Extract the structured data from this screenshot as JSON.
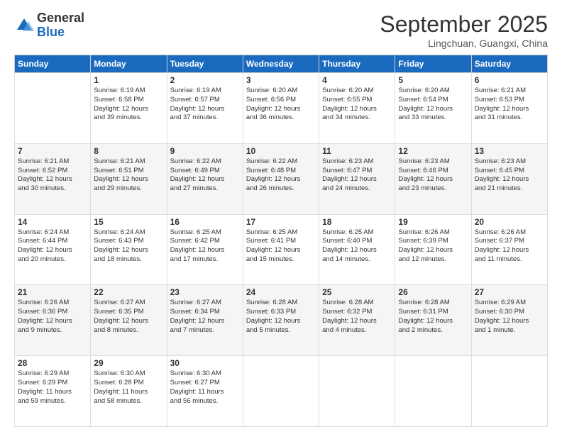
{
  "logo": {
    "general": "General",
    "blue": "Blue"
  },
  "title": "September 2025",
  "location": "Lingchuan, Guangxi, China",
  "days_of_week": [
    "Sunday",
    "Monday",
    "Tuesday",
    "Wednesday",
    "Thursday",
    "Friday",
    "Saturday"
  ],
  "weeks": [
    [
      {
        "day": "",
        "info": ""
      },
      {
        "day": "1",
        "info": "Sunrise: 6:19 AM\nSunset: 6:58 PM\nDaylight: 12 hours\nand 39 minutes."
      },
      {
        "day": "2",
        "info": "Sunrise: 6:19 AM\nSunset: 6:57 PM\nDaylight: 12 hours\nand 37 minutes."
      },
      {
        "day": "3",
        "info": "Sunrise: 6:20 AM\nSunset: 6:56 PM\nDaylight: 12 hours\nand 36 minutes."
      },
      {
        "day": "4",
        "info": "Sunrise: 6:20 AM\nSunset: 6:55 PM\nDaylight: 12 hours\nand 34 minutes."
      },
      {
        "day": "5",
        "info": "Sunrise: 6:20 AM\nSunset: 6:54 PM\nDaylight: 12 hours\nand 33 minutes."
      },
      {
        "day": "6",
        "info": "Sunrise: 6:21 AM\nSunset: 6:53 PM\nDaylight: 12 hours\nand 31 minutes."
      }
    ],
    [
      {
        "day": "7",
        "info": "Sunrise: 6:21 AM\nSunset: 6:52 PM\nDaylight: 12 hours\nand 30 minutes."
      },
      {
        "day": "8",
        "info": "Sunrise: 6:21 AM\nSunset: 6:51 PM\nDaylight: 12 hours\nand 29 minutes."
      },
      {
        "day": "9",
        "info": "Sunrise: 6:22 AM\nSunset: 6:49 PM\nDaylight: 12 hours\nand 27 minutes."
      },
      {
        "day": "10",
        "info": "Sunrise: 6:22 AM\nSunset: 6:48 PM\nDaylight: 12 hours\nand 26 minutes."
      },
      {
        "day": "11",
        "info": "Sunrise: 6:23 AM\nSunset: 6:47 PM\nDaylight: 12 hours\nand 24 minutes."
      },
      {
        "day": "12",
        "info": "Sunrise: 6:23 AM\nSunset: 6:46 PM\nDaylight: 12 hours\nand 23 minutes."
      },
      {
        "day": "13",
        "info": "Sunrise: 6:23 AM\nSunset: 6:45 PM\nDaylight: 12 hours\nand 21 minutes."
      }
    ],
    [
      {
        "day": "14",
        "info": "Sunrise: 6:24 AM\nSunset: 6:44 PM\nDaylight: 12 hours\nand 20 minutes."
      },
      {
        "day": "15",
        "info": "Sunrise: 6:24 AM\nSunset: 6:43 PM\nDaylight: 12 hours\nand 18 minutes."
      },
      {
        "day": "16",
        "info": "Sunrise: 6:25 AM\nSunset: 6:42 PM\nDaylight: 12 hours\nand 17 minutes."
      },
      {
        "day": "17",
        "info": "Sunrise: 6:25 AM\nSunset: 6:41 PM\nDaylight: 12 hours\nand 15 minutes."
      },
      {
        "day": "18",
        "info": "Sunrise: 6:25 AM\nSunset: 6:40 PM\nDaylight: 12 hours\nand 14 minutes."
      },
      {
        "day": "19",
        "info": "Sunrise: 6:26 AM\nSunset: 6:39 PM\nDaylight: 12 hours\nand 12 minutes."
      },
      {
        "day": "20",
        "info": "Sunrise: 6:26 AM\nSunset: 6:37 PM\nDaylight: 12 hours\nand 11 minutes."
      }
    ],
    [
      {
        "day": "21",
        "info": "Sunrise: 6:26 AM\nSunset: 6:36 PM\nDaylight: 12 hours\nand 9 minutes."
      },
      {
        "day": "22",
        "info": "Sunrise: 6:27 AM\nSunset: 6:35 PM\nDaylight: 12 hours\nand 8 minutes."
      },
      {
        "day": "23",
        "info": "Sunrise: 6:27 AM\nSunset: 6:34 PM\nDaylight: 12 hours\nand 7 minutes."
      },
      {
        "day": "24",
        "info": "Sunrise: 6:28 AM\nSunset: 6:33 PM\nDaylight: 12 hours\nand 5 minutes."
      },
      {
        "day": "25",
        "info": "Sunrise: 6:28 AM\nSunset: 6:32 PM\nDaylight: 12 hours\nand 4 minutes."
      },
      {
        "day": "26",
        "info": "Sunrise: 6:28 AM\nSunset: 6:31 PM\nDaylight: 12 hours\nand 2 minutes."
      },
      {
        "day": "27",
        "info": "Sunrise: 6:29 AM\nSunset: 6:30 PM\nDaylight: 12 hours\nand 1 minute."
      }
    ],
    [
      {
        "day": "28",
        "info": "Sunrise: 6:29 AM\nSunset: 6:29 PM\nDaylight: 11 hours\nand 59 minutes."
      },
      {
        "day": "29",
        "info": "Sunrise: 6:30 AM\nSunset: 6:28 PM\nDaylight: 11 hours\nand 58 minutes."
      },
      {
        "day": "30",
        "info": "Sunrise: 6:30 AM\nSunset: 6:27 PM\nDaylight: 11 hours\nand 56 minutes."
      },
      {
        "day": "",
        "info": ""
      },
      {
        "day": "",
        "info": ""
      },
      {
        "day": "",
        "info": ""
      },
      {
        "day": "",
        "info": ""
      }
    ]
  ]
}
